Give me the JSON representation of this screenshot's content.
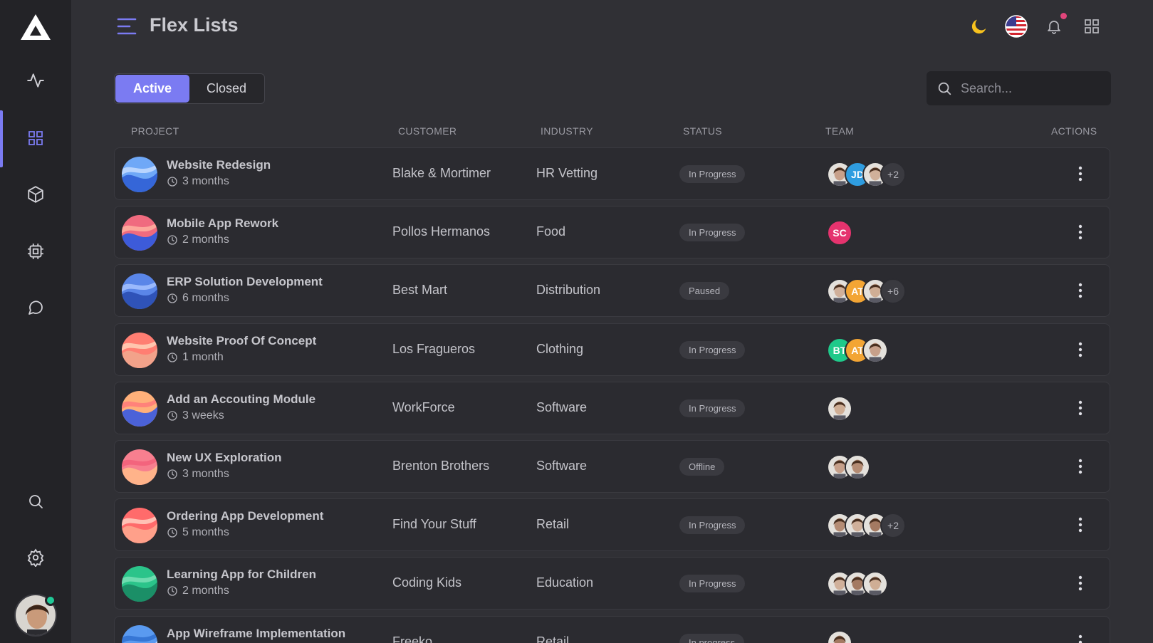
{
  "app": {
    "title": "Flex Lists"
  },
  "colors": {
    "accent": "#7b7bf2",
    "background": "#303035",
    "sidebar": "#232327",
    "online": "#20c997",
    "notification": "#e0457b"
  },
  "sidebar": {
    "items": [
      {
        "icon": "activity-icon"
      },
      {
        "icon": "grid-icon",
        "active": true
      },
      {
        "icon": "box-icon"
      },
      {
        "icon": "cpu-icon"
      },
      {
        "icon": "message-icon"
      },
      {
        "icon": "search-icon"
      },
      {
        "icon": "settings-icon"
      }
    ]
  },
  "header": {
    "icons": [
      "moon-icon",
      "us-flag-icon",
      "bell-icon",
      "apps-grid-icon"
    ]
  },
  "tabs": [
    {
      "label": "Active",
      "active": true
    },
    {
      "label": "Closed",
      "active": false
    }
  ],
  "search": {
    "placeholder": "Search..."
  },
  "columns": {
    "project": "PROJECT",
    "customer": "CUSTOMER",
    "industry": "INDUSTRY",
    "status": "STATUS",
    "team": "TEAM",
    "actions": "ACTIONS"
  },
  "rows": [
    {
      "name": "Website Redesign",
      "duration": "3 months",
      "customer": "Blake & Mortimer",
      "industry": "HR Vetting",
      "status": "In Progress",
      "team": [
        {
          "type": "photo"
        },
        {
          "type": "initials",
          "text": "JD",
          "color": "#2f9de0"
        },
        {
          "type": "photo"
        },
        {
          "type": "more",
          "text": "+2"
        }
      ]
    },
    {
      "name": "Mobile App Rework",
      "duration": "2 months",
      "customer": "Pollos Hermanos",
      "industry": "Food",
      "status": "In Progress",
      "team": [
        {
          "type": "initials",
          "text": "SC",
          "color": "#e5336e"
        }
      ]
    },
    {
      "name": "ERP Solution Development",
      "duration": "6 months",
      "customer": "Best Mart",
      "industry": "Distribution",
      "status": "Paused",
      "team": [
        {
          "type": "photo"
        },
        {
          "type": "initials",
          "text": "AT",
          "color": "#f3a534"
        },
        {
          "type": "photo"
        },
        {
          "type": "more",
          "text": "+6"
        }
      ]
    },
    {
      "name": "Website Proof Of Concept",
      "duration": "1 month",
      "customer": "Los Fragueros",
      "industry": "Clothing",
      "status": "In Progress",
      "team": [
        {
          "type": "initials",
          "text": "BT",
          "color": "#1fc98a"
        },
        {
          "type": "initials",
          "text": "AT",
          "color": "#f3a534"
        },
        {
          "type": "photo"
        }
      ]
    },
    {
      "name": "Add an Accouting Module",
      "duration": "3 weeks",
      "customer": "WorkForce",
      "industry": "Software",
      "status": "In Progress",
      "team": [
        {
          "type": "photo"
        }
      ]
    },
    {
      "name": "New UX Exploration",
      "duration": "3 months",
      "customer": "Brenton Brothers",
      "industry": "Software",
      "status": "Offline",
      "team": [
        {
          "type": "photo"
        },
        {
          "type": "photo"
        }
      ]
    },
    {
      "name": "Ordering App Development",
      "duration": "5 months",
      "customer": "Find Your Stuff",
      "industry": "Retail",
      "status": "In Progress",
      "team": [
        {
          "type": "photo"
        },
        {
          "type": "photo"
        },
        {
          "type": "photo"
        },
        {
          "type": "more",
          "text": "+2"
        }
      ]
    },
    {
      "name": "Learning App for Children",
      "duration": "2 months",
      "customer": "Coding Kids",
      "industry": "Education",
      "status": "In Progress",
      "team": [
        {
          "type": "photo"
        },
        {
          "type": "photo"
        },
        {
          "type": "photo"
        }
      ]
    },
    {
      "name": "App Wireframe Implementation",
      "duration": "",
      "customer": "Freeko",
      "industry": "Retail",
      "status": "In progress",
      "team": [
        {
          "type": "photo"
        }
      ]
    }
  ]
}
